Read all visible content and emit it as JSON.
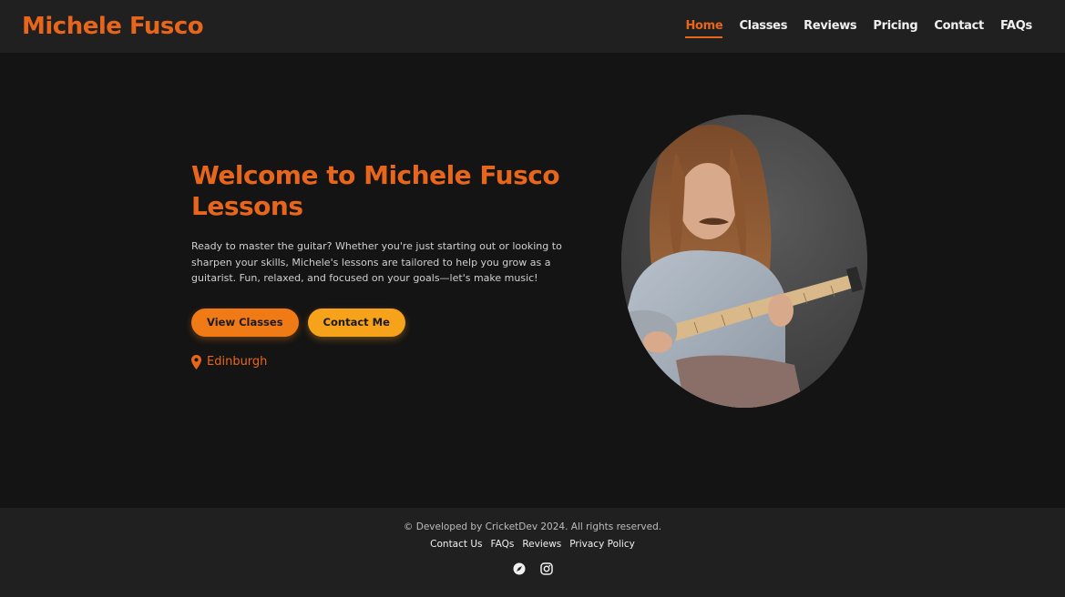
{
  "brand": "Michele Fusco",
  "nav": {
    "items": [
      {
        "label": "Home",
        "active": true
      },
      {
        "label": "Classes"
      },
      {
        "label": "Reviews"
      },
      {
        "label": "Pricing"
      },
      {
        "label": "Contact"
      },
      {
        "label": "FAQs"
      }
    ]
  },
  "hero": {
    "title": "Welcome to Michele Fusco Lessons",
    "description": "Ready to master the guitar? Whether you're just starting out or looking to sharpen your skills, Michele's lessons are tailored to help you grow as a guitarist. Fun, relaxed, and focused on your goals—let's make music!",
    "buttons": {
      "view_classes": "View Classes",
      "contact_me": "Contact Me"
    },
    "location": "Edinburgh"
  },
  "footer": {
    "copyright": "© Developed by CricketDev 2024. All rights reserved.",
    "links": [
      "Contact Us",
      "FAQs",
      "Reviews",
      "Privacy Policy"
    ],
    "social": [
      "compass-icon",
      "instagram-icon"
    ]
  },
  "colors": {
    "accent": "#e8661c",
    "button_primary": "#f07a15",
    "button_secondary": "#f7a21b",
    "background": "#141414",
    "bar": "#202020"
  }
}
